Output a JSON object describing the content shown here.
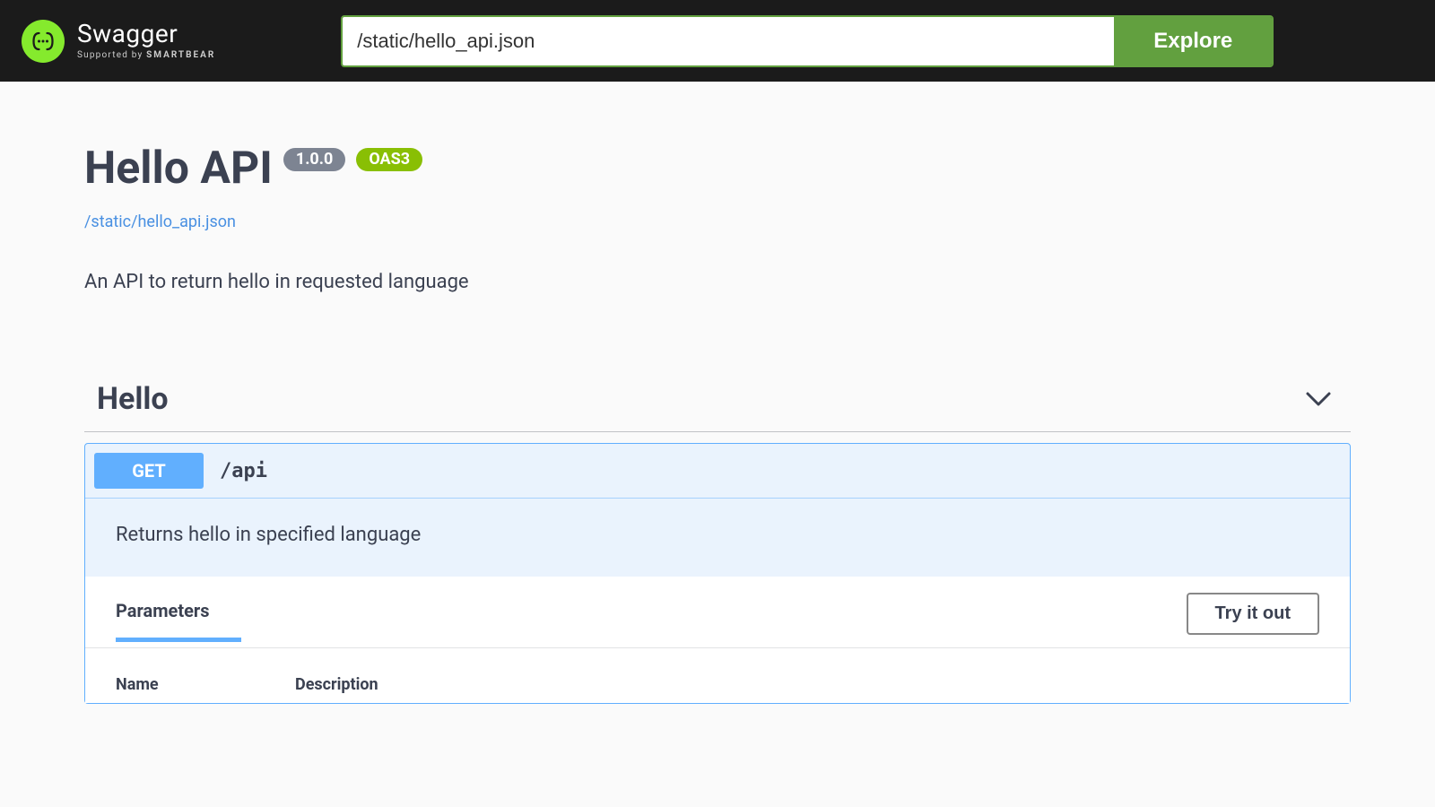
{
  "topbar": {
    "logo_main": "Swagger",
    "logo_sub_prefix": "Supported by ",
    "logo_sub_brand": "SMARTBEAR",
    "url_value": "/static/hello_api.json",
    "explore_label": "Explore"
  },
  "info": {
    "title": "Hello API",
    "version": "1.0.0",
    "oas_badge": "OAS3",
    "spec_url": "/static/hello_api.json",
    "description": "An API to return hello in requested language"
  },
  "tag": {
    "name": "Hello"
  },
  "operation": {
    "method": "GET",
    "path": "/api",
    "summary": "Returns hello in specified language",
    "params_title": "Parameters",
    "try_label": "Try it out",
    "col_name": "Name",
    "col_desc": "Description"
  }
}
